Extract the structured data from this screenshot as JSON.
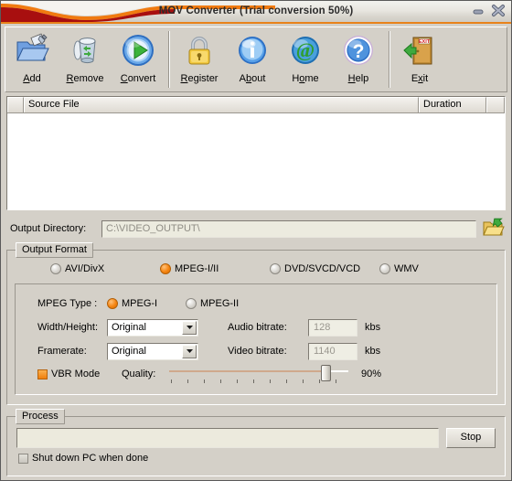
{
  "window": {
    "title": "MOV Converter (Trial conversion 50%)",
    "minimize_label": "minimize",
    "close_label": "close",
    "accent_color": "#ef7f0c",
    "titlebar_wave_colors": [
      "#a80f0f",
      "#f07a10"
    ],
    "background_color": "#d4d0c8"
  },
  "toolbar": {
    "buttons": [
      {
        "name": "add",
        "label": "Add",
        "accesskey": "A"
      },
      {
        "name": "remove",
        "label": "Remove",
        "accesskey": "R"
      },
      {
        "name": "convert",
        "label": "Convert",
        "accesskey": "C"
      },
      {
        "name": "register",
        "label": "Register",
        "accesskey": "R"
      },
      {
        "name": "about",
        "label": "About",
        "accesskey": "b"
      },
      {
        "name": "home",
        "label": "Home",
        "accesskey": "o"
      },
      {
        "name": "help",
        "label": "Help",
        "accesskey": "H"
      },
      {
        "name": "exit",
        "label": "Exit",
        "accesskey": "x"
      }
    ]
  },
  "file_list": {
    "columns": [
      "",
      "Source File",
      "Duration",
      ""
    ],
    "rows": []
  },
  "output_directory": {
    "label": "Output Directory:",
    "value": "C:\\VIDEO_OUTPUT\\",
    "browse_icon": "folder-open-icon"
  },
  "output_format": {
    "title": "Output Format",
    "options": [
      {
        "label": "AVI/DivX",
        "selected": false
      },
      {
        "label": "MPEG-I/II",
        "selected": true
      },
      {
        "label": "DVD/SVCD/VCD",
        "selected": false
      },
      {
        "label": "WMV",
        "selected": false
      }
    ],
    "mpeg_type": {
      "label": "MPEG Type :",
      "options": [
        {
          "label": "MPEG-I",
          "selected": true
        },
        {
          "label": "MPEG-II",
          "selected": false
        }
      ]
    },
    "width_height": {
      "label": "Width/Height:",
      "value": "Original"
    },
    "framerate": {
      "label": "Framerate:",
      "value": "Original"
    },
    "audio_bitrate": {
      "label": "Audio bitrate:",
      "value": "128",
      "unit": "kbs"
    },
    "video_bitrate": {
      "label": "Video bitrate:",
      "value": "1140",
      "unit": "kbs"
    },
    "vbr_mode": {
      "label": "VBR Mode",
      "checked": true
    },
    "quality": {
      "label": "Quality:",
      "value": "90%",
      "percent": 90
    }
  },
  "process": {
    "title": "Process",
    "progress_value": "",
    "stop_label": "Stop",
    "shutdown": {
      "label": "Shut down PC when done",
      "checked": false
    }
  }
}
